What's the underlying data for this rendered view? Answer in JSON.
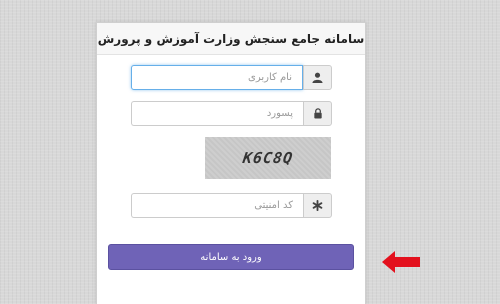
{
  "header": {
    "title": "سامانه جامع سنجش وزارت آموزش و پرورش"
  },
  "form": {
    "username_placeholder": "نام کاربری",
    "password_placeholder": "پسورد",
    "captcha_text": "K6C8Q",
    "captcha_placeholder": "کد امنیتی",
    "submit_label": "ورود به سامانه"
  },
  "icons": {
    "user": "user-icon",
    "lock": "lock-icon",
    "captcha_field": "asterisk-icon",
    "pointer": "arrow-left-icon"
  },
  "colors": {
    "button": "#6f63b7",
    "focus": "#66afe9",
    "arrow": "#e3101d"
  }
}
